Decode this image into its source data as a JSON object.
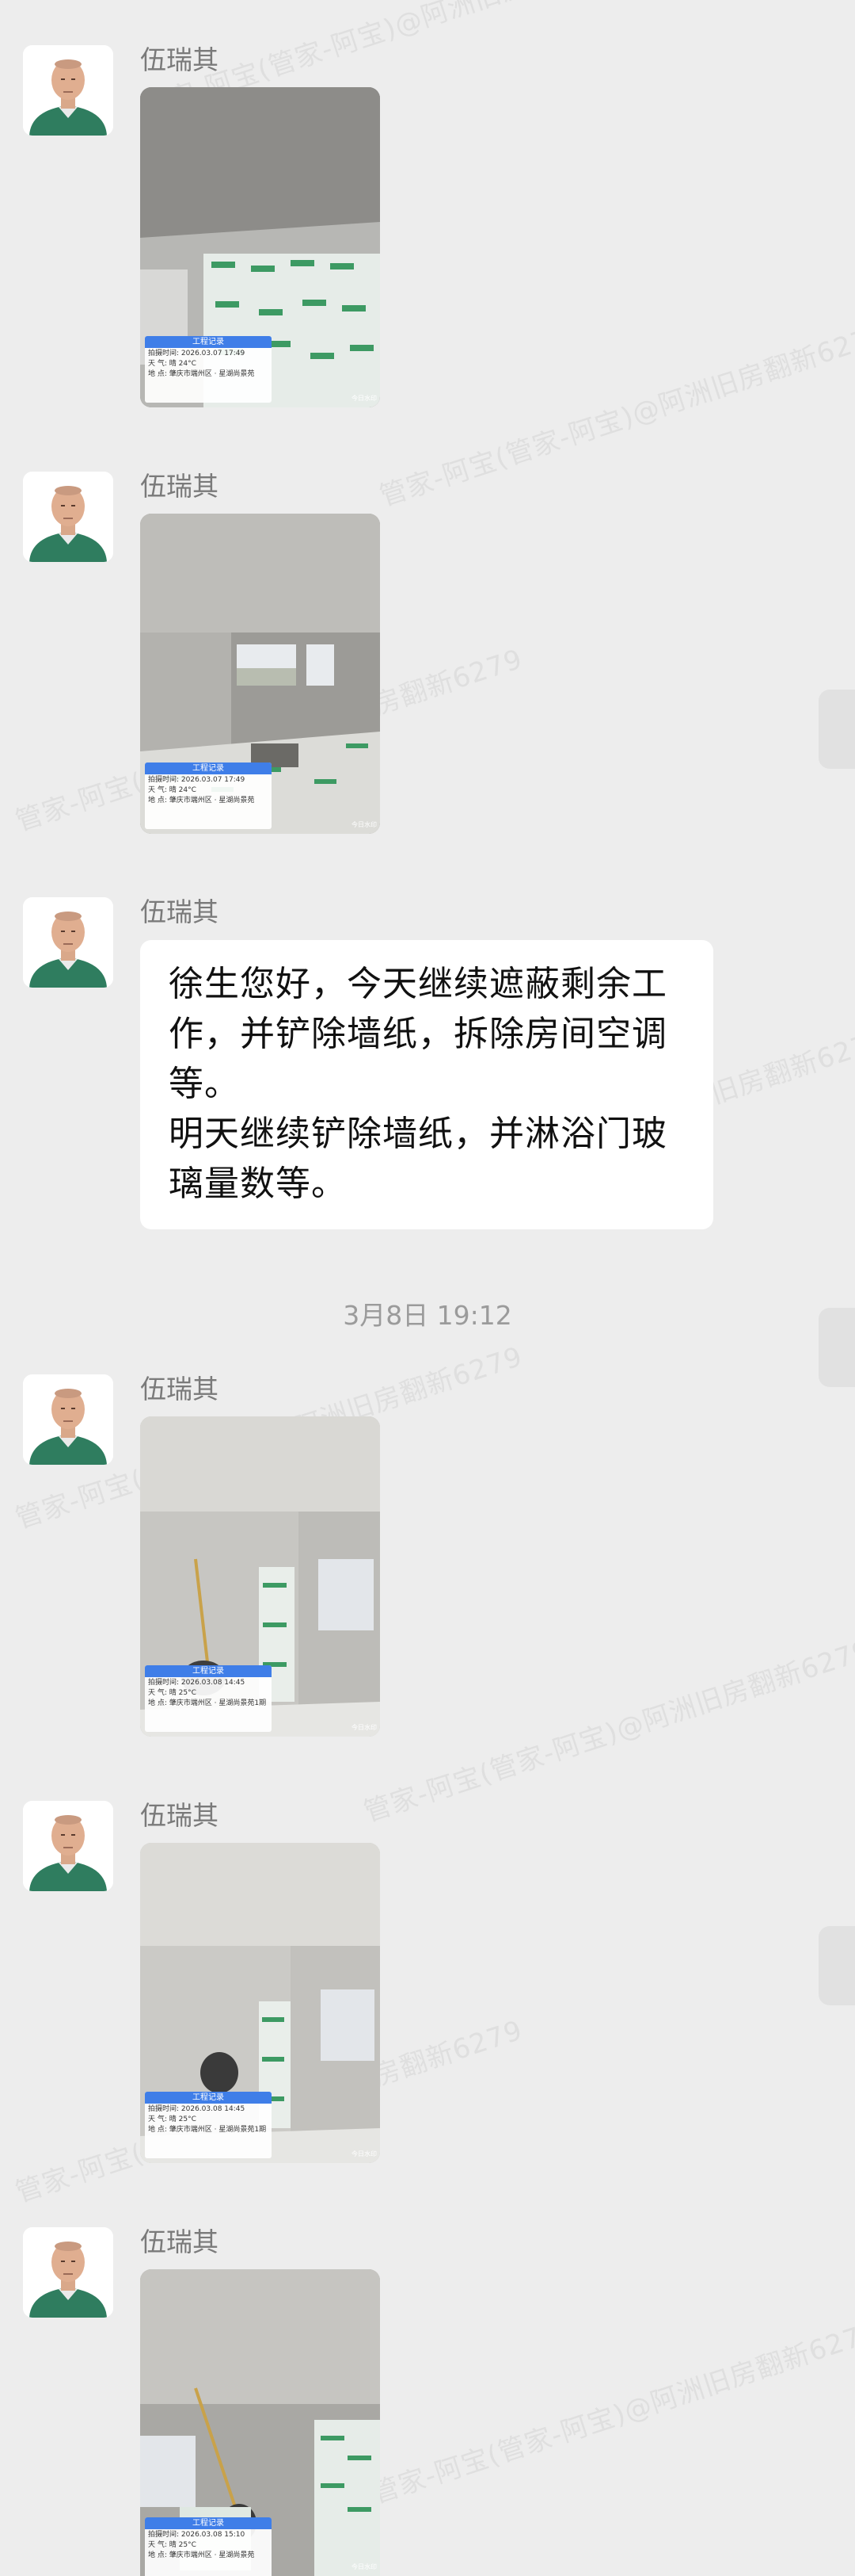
{
  "sender_name": "伍瑞其",
  "watermark_text": "管家-阿宝(管家-阿宝)@阿洲旧房翻新6279",
  "timestamp": "3月8日  19:12",
  "text_message": {
    "paragraph1": "徐生您好，今天继续遮蔽剩余工作，并铲除墙纸，拆除房间空调等。",
    "paragraph2": "明天继续铲除墙纸，并淋浴门玻璃量数等。"
  },
  "photos": [
    {
      "card_title": "工程记录",
      "time": "拍摄时间: 2026.03.07 17:49",
      "weather": "天    气: 晴 24°C",
      "address": "地    点: 肇庆市端州区 · 星湖尚景苑",
      "stamp": "今日水印"
    },
    {
      "card_title": "工程记录",
      "time": "拍摄时间: 2026.03.07 17:49",
      "weather": "天    气: 晴 24°C",
      "address": "地    点: 肇庆市端州区 · 星湖尚景苑",
      "stamp": "今日水印"
    },
    {
      "card_title": "工程记录",
      "time": "拍摄时间: 2026.03.08 14:45",
      "weather": "天    气: 晴 25°C",
      "address": "地    点: 肇庆市端州区 · 星湖尚景苑1期",
      "stamp": "今日水印"
    },
    {
      "card_title": "工程记录",
      "time": "拍摄时间: 2026.03.08 14:45",
      "weather": "天    气: 晴 25°C",
      "address": "地    点: 肇庆市端州区 · 星湖尚景苑1期",
      "stamp": "今日水印"
    },
    {
      "card_title": "工程记录",
      "time": "拍摄时间: 2026.03.08 15:10",
      "weather": "天    气: 晴 25°C",
      "address": "地    点: 肇庆市端州区 · 星湖尚景苑",
      "stamp": "今日水印"
    }
  ],
  "colors": {
    "background": "#ededed",
    "bubble": "#ffffff",
    "card_header": "#3f7ee8",
    "avatar_shirt": "#2f7d5f"
  }
}
